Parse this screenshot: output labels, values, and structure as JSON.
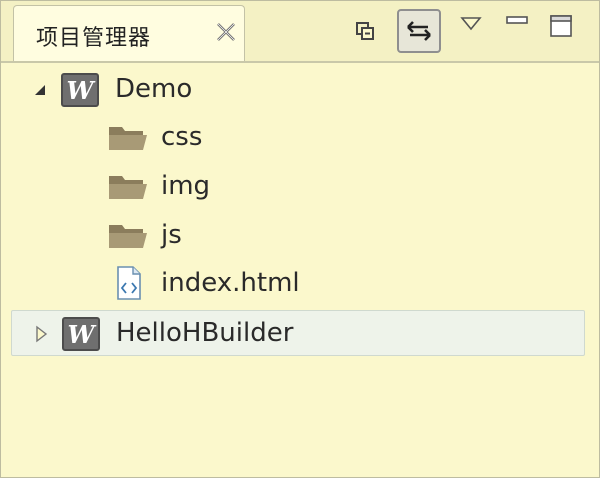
{
  "tab": {
    "title": "项目管理器"
  },
  "tree": {
    "items": [
      {
        "label": "Demo",
        "kind": "project",
        "expanded": true,
        "depth": 0
      },
      {
        "label": "css",
        "kind": "folder",
        "depth": 1
      },
      {
        "label": "img",
        "kind": "folder",
        "depth": 1
      },
      {
        "label": "js",
        "kind": "folder",
        "depth": 1
      },
      {
        "label": "index.html",
        "kind": "html-file",
        "depth": 1
      },
      {
        "label": "HelloHBuilder",
        "kind": "project",
        "expanded": false,
        "depth": 0,
        "selected": true
      }
    ]
  },
  "colors": {
    "background": "#fbf8cc",
    "folder": "#a49570",
    "project_icon": "#6f6f6f",
    "selection": "#eef3ea"
  },
  "toolbar": {
    "icons": [
      "collapse-all-icon",
      "link-with-editor-icon",
      "view-menu-icon",
      "minimize-icon",
      "maximize-icon"
    ]
  }
}
